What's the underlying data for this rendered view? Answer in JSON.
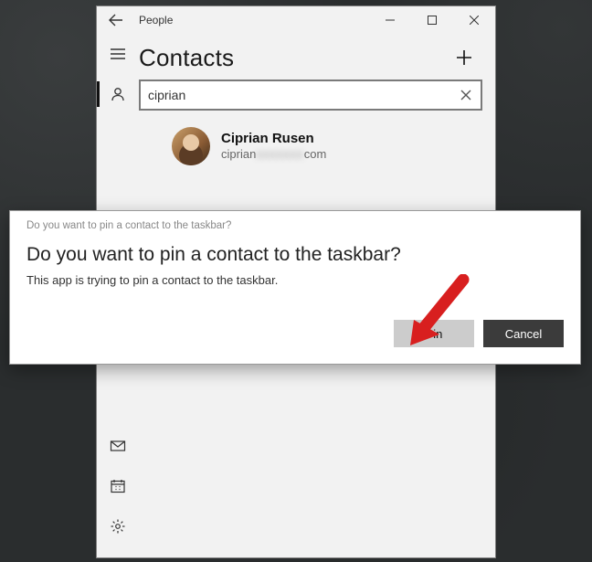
{
  "window": {
    "title": "People"
  },
  "header": {
    "title": "Contacts"
  },
  "search": {
    "value": "ciprian"
  },
  "result": {
    "name": "Ciprian Rusen",
    "email_prefix": "ciprian",
    "email_blur": "xxxxxxx",
    "email_suffix": "com"
  },
  "dialog": {
    "caption": "Do you want to pin a contact to the taskbar?",
    "title": "Do you want to pin a contact to the taskbar?",
    "body": "This app is trying to pin a contact to the taskbar.",
    "pin_label": "Pin",
    "cancel_label": "Cancel"
  },
  "icons": {
    "hamburger": "hamburger-icon",
    "contacts": "person-icon",
    "mail": "mail-icon",
    "calendar": "calendar-icon",
    "settings": "gear-icon"
  }
}
